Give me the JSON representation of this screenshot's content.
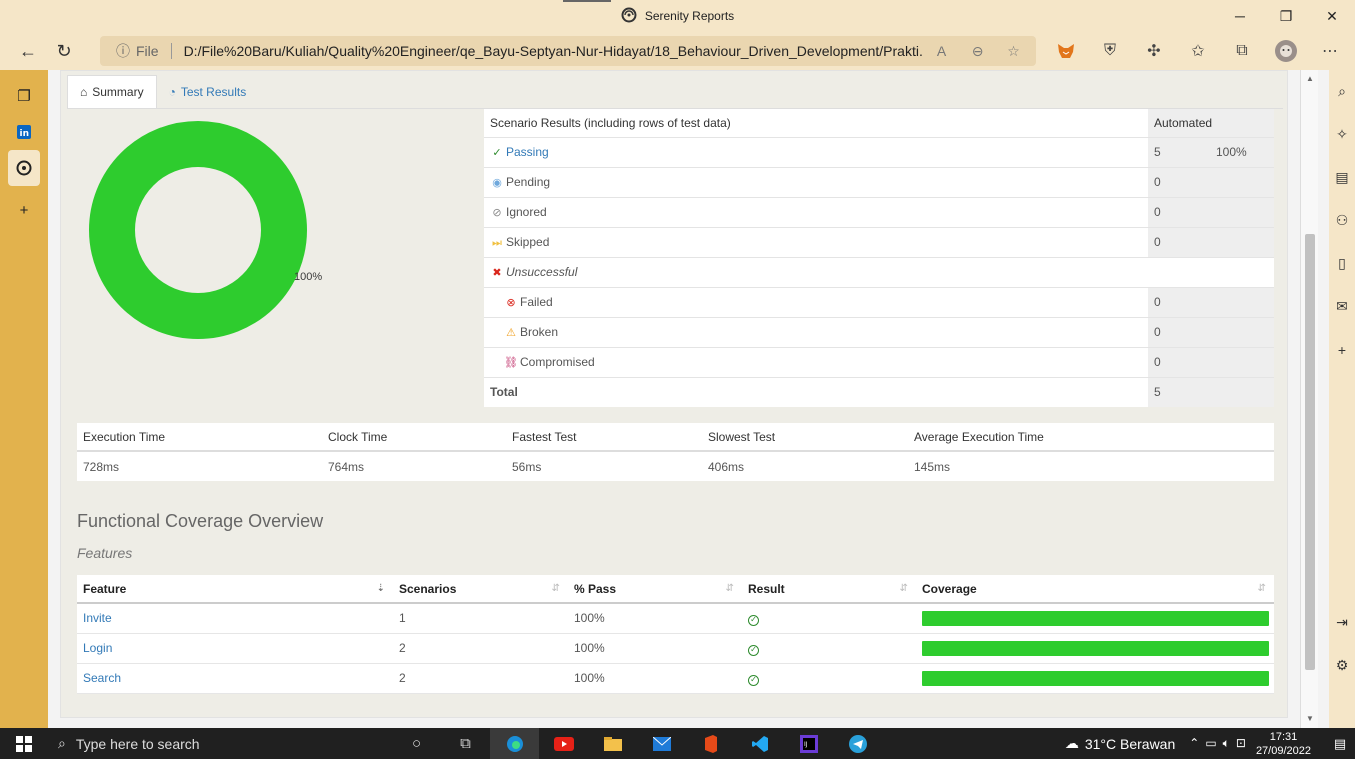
{
  "window": {
    "title": "Serenity Reports",
    "minimize": "─",
    "maximize": "❐",
    "close": "✕"
  },
  "addressbar": {
    "info_icon": "info-icon",
    "scheme_label": "File",
    "url": "D:/File%20Baru/Kuliah/Quality%20Engineer/qe_Bayu-Septyan-Nur-Hidayat/18_Behaviour_Driven_Development/Prakti..."
  },
  "tabs": [
    {
      "label": "Summary",
      "icon": "home-icon"
    },
    {
      "label": "Test Results",
      "icon": "dashboard-icon"
    }
  ],
  "donut": {
    "label": "100%",
    "color": "#2ecc2e"
  },
  "scenario_results": {
    "header_label": "Scenario Results (including rows of test data)",
    "header_col": "Automated",
    "rows": [
      {
        "label": "Passing",
        "value": "5",
        "pct": "100%"
      },
      {
        "label": "Pending",
        "value": "0"
      },
      {
        "label": "Ignored",
        "value": "0"
      },
      {
        "label": "Skipped",
        "value": "0"
      },
      {
        "label": "Unsuccessful"
      },
      {
        "label": "Failed",
        "value": "0"
      },
      {
        "label": "Broken",
        "value": "0"
      },
      {
        "label": "Compromised",
        "value": "0"
      },
      {
        "label": "Total",
        "value": "5"
      }
    ]
  },
  "execution": {
    "headers": [
      "Execution Time",
      "Clock Time",
      "Fastest Test",
      "Slowest Test",
      "Average Execution Time"
    ],
    "values": [
      "728ms",
      "764ms",
      "56ms",
      "406ms",
      "145ms"
    ]
  },
  "coverage": {
    "title": "Functional Coverage Overview",
    "subtitle": "Features",
    "headers": [
      "Feature",
      "Scenarios",
      "% Pass",
      "Result",
      "Coverage"
    ],
    "rows": [
      {
        "feature": "Invite",
        "scenarios": "1",
        "pass": "100%",
        "coverage": 1.0
      },
      {
        "feature": "Login",
        "scenarios": "2",
        "pass": "100%",
        "coverage": 1.0
      },
      {
        "feature": "Search",
        "scenarios": "2",
        "pass": "100%",
        "coverage": 1.0
      }
    ]
  },
  "taskbar": {
    "search_placeholder": "Type here to search",
    "weather": "31°C  Berawan",
    "time": "17:31",
    "date": "27/09/2022"
  },
  "colors": {
    "pass_green": "#2ecc2e",
    "link_blue": "#337ab7",
    "browser_frame": "#f5e6c8",
    "sidebar": "#e2b24d"
  }
}
